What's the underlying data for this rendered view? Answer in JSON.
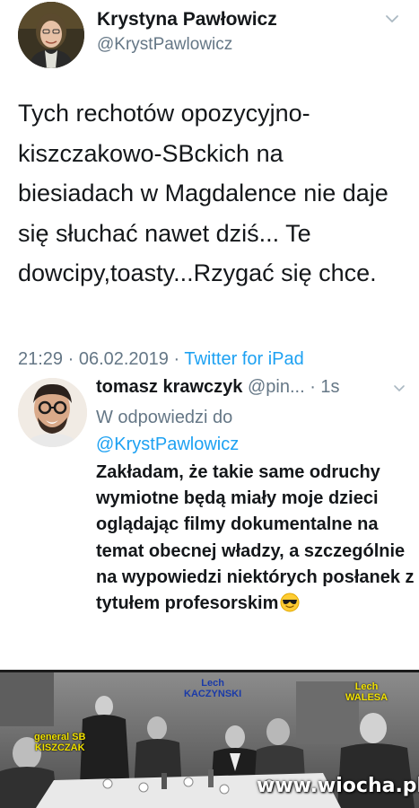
{
  "tweet": {
    "author_name": "Krystyna Pawłowicz",
    "author_handle": "@KrystPawlowicz",
    "text": "Tych rechotów opozycyjno-kiszczakowo-SBckich na biesiadach w Magdalence nie daje się  słuchać nawet dziś... Te dowcipy,toasty...Rzygać się chce.",
    "timestamp": "21:29 · 06.02.2019 · ",
    "source": "Twitter for iPad",
    "menu_icon": "chevron-down-icon"
  },
  "reply": {
    "author_name": "tomasz krawczyk",
    "author_handle": "@pin...",
    "age": "· 1s",
    "reply_to_label": "W odpowiedzi do",
    "reply_to_handle": "@KrystPawlowicz",
    "text": "Zakładam, że takie same odruchy wymiotne będą miały moje dzieci oglądając filmy dokumentalne na temat obecnej władzy, a szczególnie na wypowiedzi niektórych posłanek z tytułem profesorskim",
    "emoji": "sunglasses-emoji"
  },
  "photo": {
    "label_kaczynski": "Lech\nKACZYNSKI",
    "label_walesa": "Lech\nWALESA",
    "label_kiszczak": "general SB\nKISZCZAK",
    "watermark": "www.wiocha.pl"
  },
  "colors": {
    "text": "#14171a",
    "secondary": "#657786",
    "link": "#1da1f2"
  }
}
